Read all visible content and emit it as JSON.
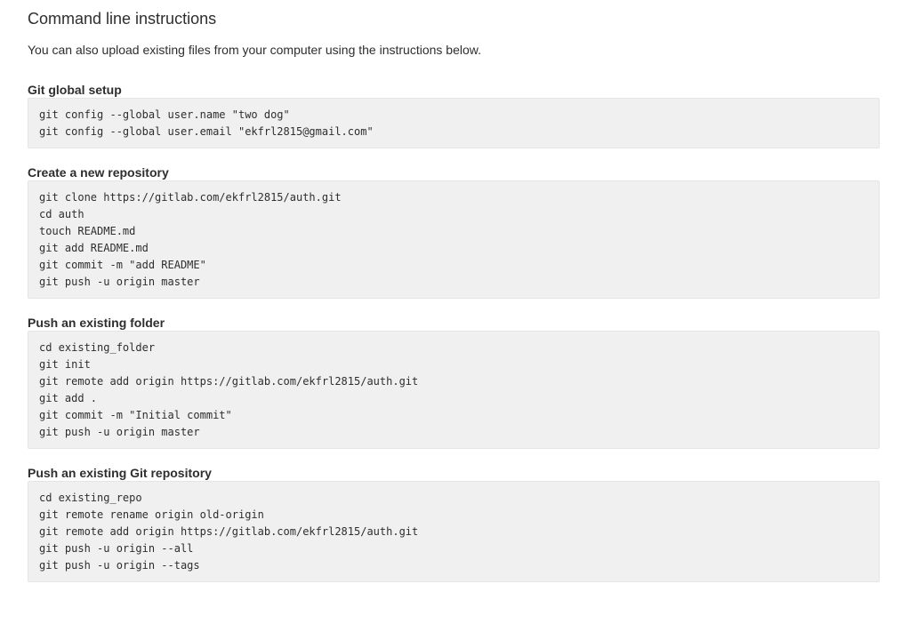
{
  "page_title": "Command line instructions",
  "intro": "You can also upload existing files from your computer using the instructions below.",
  "sections": [
    {
      "title": "Git global setup",
      "lines": [
        "git config --global user.name \"two dog\"",
        "git config --global user.email \"ekfrl2815@gmail.com\""
      ]
    },
    {
      "title": "Create a new repository",
      "lines": [
        "git clone https://gitlab.com/ekfrl2815/auth.git",
        "cd auth",
        "touch README.md",
        "git add README.md",
        "git commit -m \"add README\"",
        "git push -u origin master"
      ]
    },
    {
      "title": "Push an existing folder",
      "lines": [
        "cd existing_folder",
        "git init",
        "git remote add origin https://gitlab.com/ekfrl2815/auth.git",
        "git add .",
        "git commit -m \"Initial commit\"",
        "git push -u origin master"
      ]
    },
    {
      "title": "Push an existing Git repository",
      "lines": [
        "cd existing_repo",
        "git remote rename origin old-origin",
        "git remote add origin https://gitlab.com/ekfrl2815/auth.git",
        "git push -u origin --all",
        "git push -u origin --tags"
      ]
    }
  ]
}
